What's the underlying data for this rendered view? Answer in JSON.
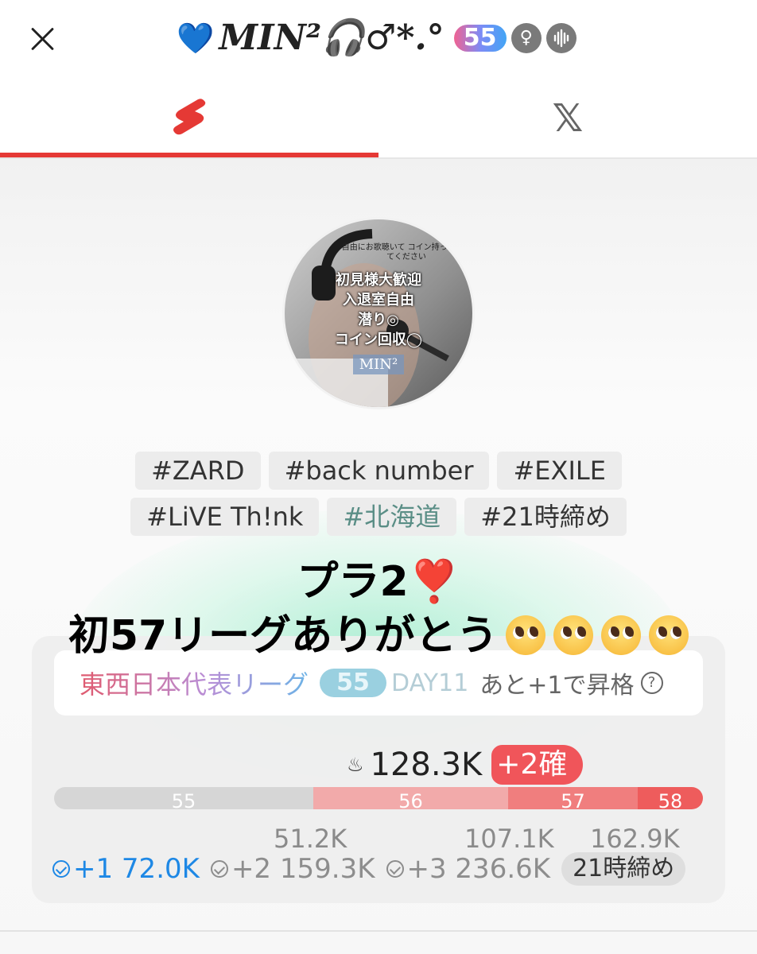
{
  "header": {
    "title": "MIN²🎧♂*.°",
    "heart": "💙",
    "level": "55",
    "gender_icon": "♀",
    "audio_icon": "audio-waveform-icon"
  },
  "tabs": [
    {
      "label": "",
      "icon": "shorts-s-icon",
      "active": true
    },
    {
      "label": "",
      "icon": "x-logo-icon",
      "active": false
    }
  ],
  "avatar": {
    "top_text": "自由にお歌聴いて\nコイン持っていってください",
    "lines": [
      "初見様大歓迎",
      "入退室自由",
      "潜り◎",
      "コイン回収◯"
    ],
    "name": "MIN²"
  },
  "tags": [
    [
      "#ZARD",
      "#back number",
      "#EXILE"
    ],
    [
      "#LiVE Th!nk",
      "#北海道",
      "#21時締め"
    ]
  ],
  "caption": {
    "line1": "プラ2",
    "line1_emoji": "❣️",
    "line2": "初57リーグありがとう",
    "emoji_count": 4
  },
  "league": {
    "name": "東西日本代表リーグ",
    "badge": "55",
    "day": "DAY11",
    "promo": "あと+1で昇格",
    "help": "?",
    "score": "128.3K",
    "score_badge": "+2確",
    "segments": [
      {
        "label": "55",
        "color": "#d6d6d6",
        "share": 0.4
      },
      {
        "label": "56",
        "color": "#f2aaaa",
        "share": 0.3
      },
      {
        "label": "57",
        "color": "#f07e7e",
        "share": 0.2
      },
      {
        "label": "58",
        "color": "#ee5c5c",
        "share": 0.1
      }
    ],
    "thresholds": [
      "51.2K",
      "107.1K",
      "162.9K"
    ],
    "stats": [
      {
        "label": "+1 72.0K",
        "active": true
      },
      {
        "label": "+2 159.3K",
        "active": false
      },
      {
        "label": "+3 236.6K",
        "active": false
      }
    ],
    "deadline": "21時締め"
  }
}
